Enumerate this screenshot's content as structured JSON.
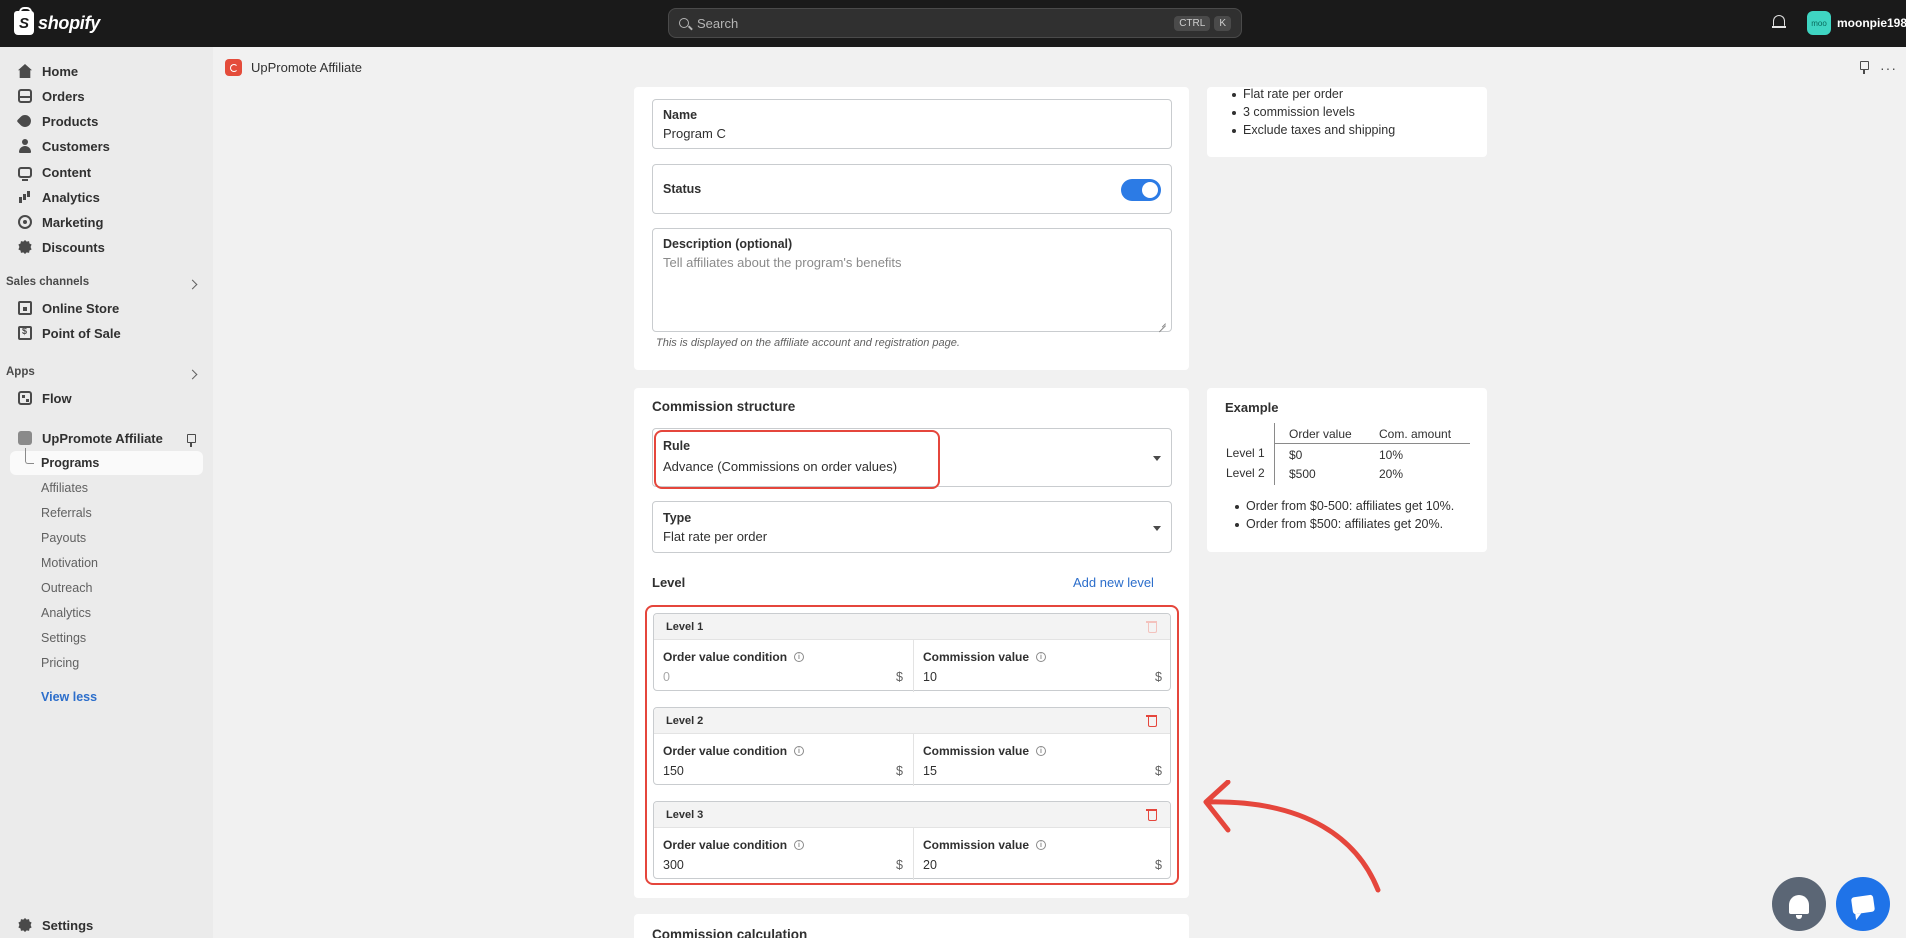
{
  "topbar": {
    "brand": "shopify",
    "search_placeholder": "Search",
    "shortcut_keys": [
      "CTRL",
      "K"
    ],
    "avatar_initials": "moo",
    "user_name": "moonpie198"
  },
  "sidebar": {
    "items": [
      {
        "label": "Home",
        "icon": "home-icon"
      },
      {
        "label": "Orders",
        "icon": "orders-icon"
      },
      {
        "label": "Products",
        "icon": "products-icon"
      },
      {
        "label": "Customers",
        "icon": "customers-icon"
      },
      {
        "label": "Content",
        "icon": "content-icon"
      },
      {
        "label": "Analytics",
        "icon": "analytics-icon"
      },
      {
        "label": "Marketing",
        "icon": "marketing-icon"
      },
      {
        "label": "Discounts",
        "icon": "discounts-icon"
      }
    ],
    "sales_channels_label": "Sales channels",
    "sales_channels": [
      {
        "label": "Online Store",
        "icon": "online-store-icon"
      },
      {
        "label": "Point of Sale",
        "icon": "point-of-sale-icon"
      }
    ],
    "apps_label": "Apps",
    "apps": [
      {
        "label": "Flow",
        "icon": "flow-icon"
      },
      {
        "label": "UpPromote Affiliate",
        "icon": "uppromote-icon"
      }
    ],
    "app_sub_items": [
      "Programs",
      "Affiliates",
      "Referrals",
      "Payouts",
      "Motivation",
      "Outreach",
      "Analytics",
      "Settings",
      "Pricing"
    ],
    "view_less": "View less",
    "settings": "Settings"
  },
  "app_header": {
    "title": "UpPromote Affiliate"
  },
  "program_form": {
    "name_label": "Name",
    "name_value": "Program C",
    "status_label": "Status",
    "status_on": true,
    "description_label": "Description (optional)",
    "description_placeholder": "Tell affiliates about the program's benefits",
    "description_hint": "This is displayed on the affiliate account and registration page."
  },
  "summary_card": {
    "bullets": [
      "Flat rate per order",
      "3 commission levels",
      "Exclude taxes and shipping"
    ]
  },
  "commission_structure": {
    "title": "Commission structure",
    "rule_label": "Rule",
    "rule_value": "Advance (Commissions on order values)",
    "type_label": "Type",
    "type_value": "Flat rate per order",
    "level_label": "Level",
    "add_level": "Add new level",
    "levels": [
      {
        "title": "Level 1",
        "cond_label": "Order value condition",
        "cond_value": "0",
        "cond_unit": "$",
        "comm_label": "Commission value",
        "comm_value": "10",
        "comm_unit": "$"
      },
      {
        "title": "Level 2",
        "cond_label": "Order value condition",
        "cond_value": "150",
        "cond_unit": "$",
        "comm_label": "Commission value",
        "comm_value": "15",
        "comm_unit": "$"
      },
      {
        "title": "Level 3",
        "cond_label": "Order value condition",
        "cond_value": "300",
        "cond_unit": "$",
        "comm_label": "Commission value",
        "comm_value": "20",
        "comm_unit": "$"
      }
    ]
  },
  "example_card": {
    "title": "Example",
    "headers": [
      "Order value",
      "Com. amount"
    ],
    "rows": [
      {
        "level": "Level 1",
        "order": "$0",
        "amount": "10%"
      },
      {
        "level": "Level 2",
        "order": "$500",
        "amount": "20%"
      }
    ],
    "bullets": [
      "Order from $0-500: affiliates get 10%.",
      "Order from $500: affiliates get 20%."
    ]
  },
  "commission_calculation": {
    "title": "Commission calculation"
  },
  "colors": {
    "accent_blue": "#2c7be5",
    "annotation_red": "#e5463c"
  }
}
